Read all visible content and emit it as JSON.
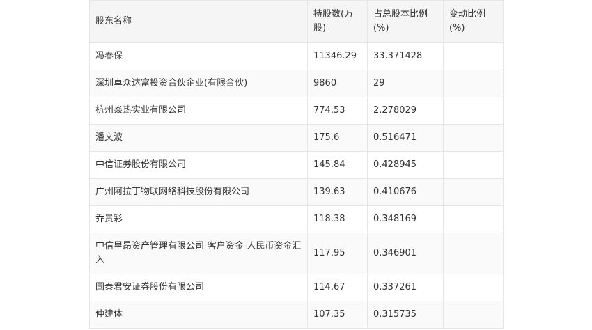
{
  "table": {
    "headers": [
      "股东名称",
      "持股数(万股)",
      "占总股本比例(%)",
      "变动比例(%)"
    ],
    "rows": [
      {
        "name": "冯春保",
        "shares": "11346.29",
        "ratio": "33.371428",
        "change": ""
      },
      {
        "name": "深圳卓众达富投资合伙企业(有限合伙)",
        "shares": "9860",
        "ratio": "29",
        "change": ""
      },
      {
        "name": "杭州焱热实业有限公司",
        "shares": "774.53",
        "ratio": "2.278029",
        "change": ""
      },
      {
        "name": "潘文波",
        "shares": "175.6",
        "ratio": "0.516471",
        "change": ""
      },
      {
        "name": "中信证券股份有限公司",
        "shares": "145.84",
        "ratio": "0.428945",
        "change": ""
      },
      {
        "name": "广州阿拉丁物联网络科技股份有限公司",
        "shares": "139.63",
        "ratio": "0.410676",
        "change": ""
      },
      {
        "name": "乔贵彩",
        "shares": "118.38",
        "ratio": "0.348169",
        "change": ""
      },
      {
        "name": "中信里昂资产管理有限公司-客户资金-人民币资金汇入",
        "shares": "117.95",
        "ratio": "0.346901",
        "change": ""
      },
      {
        "name": "国泰君安证券股份有限公司",
        "shares": "114.67",
        "ratio": "0.337261",
        "change": ""
      },
      {
        "name": "仲建体",
        "shares": "107.35",
        "ratio": "0.315735",
        "change": ""
      }
    ]
  }
}
